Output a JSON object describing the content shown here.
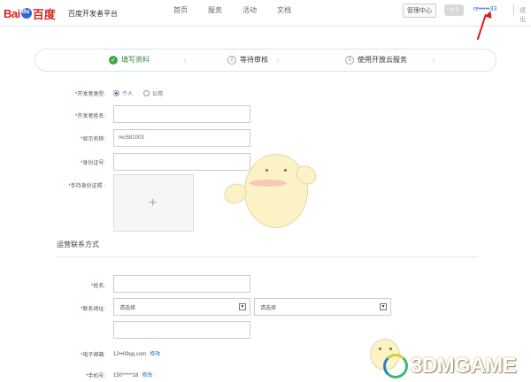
{
  "header": {
    "logo": {
      "bai": "Bai",
      "du": "百度"
    },
    "site_name": "百度开发者平台",
    "nav": [
      "首页",
      "服务",
      "活动",
      "文档"
    ],
    "admin_label": "管理中心",
    "msg_label": "0",
    "username": "re•••••33",
    "logout": "退出"
  },
  "steps": [
    {
      "label": "填写资料",
      "state": "done"
    },
    {
      "label": "等待审核",
      "num": "2"
    },
    {
      "label": "使用开放云服务",
      "num": "3"
    }
  ],
  "form": {
    "dev_type_label": "开发者类型:",
    "dev_type_options": [
      "个人",
      "公司"
    ],
    "dev_type_selected": "个人",
    "dev_name_label": "开发者姓名:",
    "display_name_label": "显示名称:",
    "display_name_value": "reo581003",
    "id_number_label": "身份证号:",
    "id_photo_label": "手持身份证照 :",
    "upload_plus": "+",
    "section_title": "运营联系方式",
    "name_label": "姓名:",
    "address_label": "联系地址:",
    "province_placeholder": "请选择",
    "city_placeholder": "请选择",
    "email_label": "电子邮箱:",
    "email_value": "12••09qq.com",
    "email_edit": "修改",
    "phone_label": "手机号:",
    "phone_value": "150*****18",
    "phone_edit": "修改"
  },
  "watermark": {
    "text": "3DMGAME"
  },
  "colors": {
    "accent": "#2a6fc9",
    "success": "#44a84b",
    "required": "#d81e1e",
    "annotation": "#d81e1e"
  }
}
